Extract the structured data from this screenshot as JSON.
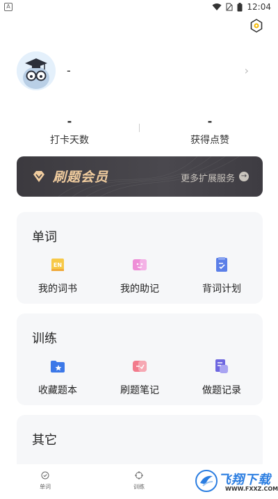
{
  "status_bar": {
    "left_badge": "A",
    "time": "12:04"
  },
  "profile": {
    "name": "-",
    "chevron": "›"
  },
  "stats": [
    {
      "value": "-",
      "label": "打卡天数"
    },
    {
      "value": "-",
      "label": "获得点赞"
    }
  ],
  "vip": {
    "title": "刷题会员",
    "more": "更多扩展服务",
    "arrow": "→"
  },
  "sections": {
    "words": {
      "title": "单词",
      "items": [
        {
          "label": "我的词书",
          "icon": "word-book-icon"
        },
        {
          "label": "我的助记",
          "icon": "mnemonic-icon"
        },
        {
          "label": "背词计划",
          "icon": "study-plan-icon"
        }
      ]
    },
    "training": {
      "title": "训练",
      "items": [
        {
          "label": "收藏题本",
          "icon": "favorites-folder-icon"
        },
        {
          "label": "刷题笔记",
          "icon": "notes-icon"
        },
        {
          "label": "做题记录",
          "icon": "records-icon"
        }
      ]
    },
    "other": {
      "title": "其它"
    }
  },
  "bottom_nav": [
    {
      "label": "单词",
      "icon": "word-tab-icon"
    },
    {
      "label": "训练",
      "icon": "training-tab-icon"
    }
  ],
  "watermark": {
    "title": "飞翔下载",
    "subtitle": "WWW.FXXZ.COM"
  },
  "colors": {
    "accent_gold": "#f1cd9f",
    "banner_bg": "#434146",
    "card_bg": "#f6f7f9",
    "watermark_blue": "#2a7de1"
  }
}
